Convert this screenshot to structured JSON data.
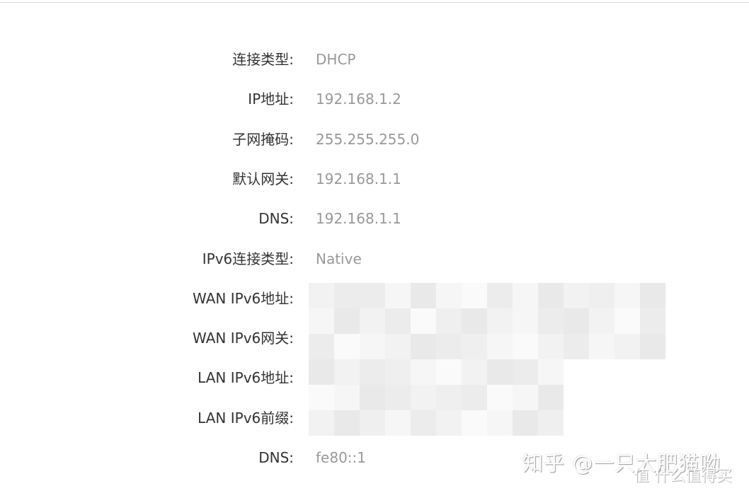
{
  "rows": [
    {
      "label": "连接类型:",
      "value": "DHCP"
    },
    {
      "label": "IP地址:",
      "value": "192.168.1.2"
    },
    {
      "label": "子网掩码:",
      "value": "255.255.255.0"
    },
    {
      "label": "默认网关:",
      "value": "192.168.1.1"
    },
    {
      "label": "DNS:",
      "value": "192.168.1.1"
    },
    {
      "label": "IPv6连接类型:",
      "value": "Native"
    },
    {
      "label": "WAN IPv6地址:",
      "value": ""
    },
    {
      "label": "WAN IPv6网关:",
      "value": ""
    },
    {
      "label": "LAN IPv6地址:",
      "value": ""
    },
    {
      "label": "LAN IPv6前缀:",
      "value": ""
    },
    {
      "label": "DNS:",
      "value": "fe80::1"
    }
  ],
  "watermark": {
    "primary": "知乎 @一只大肥猫呦",
    "secondary": "值 什么值得买"
  }
}
